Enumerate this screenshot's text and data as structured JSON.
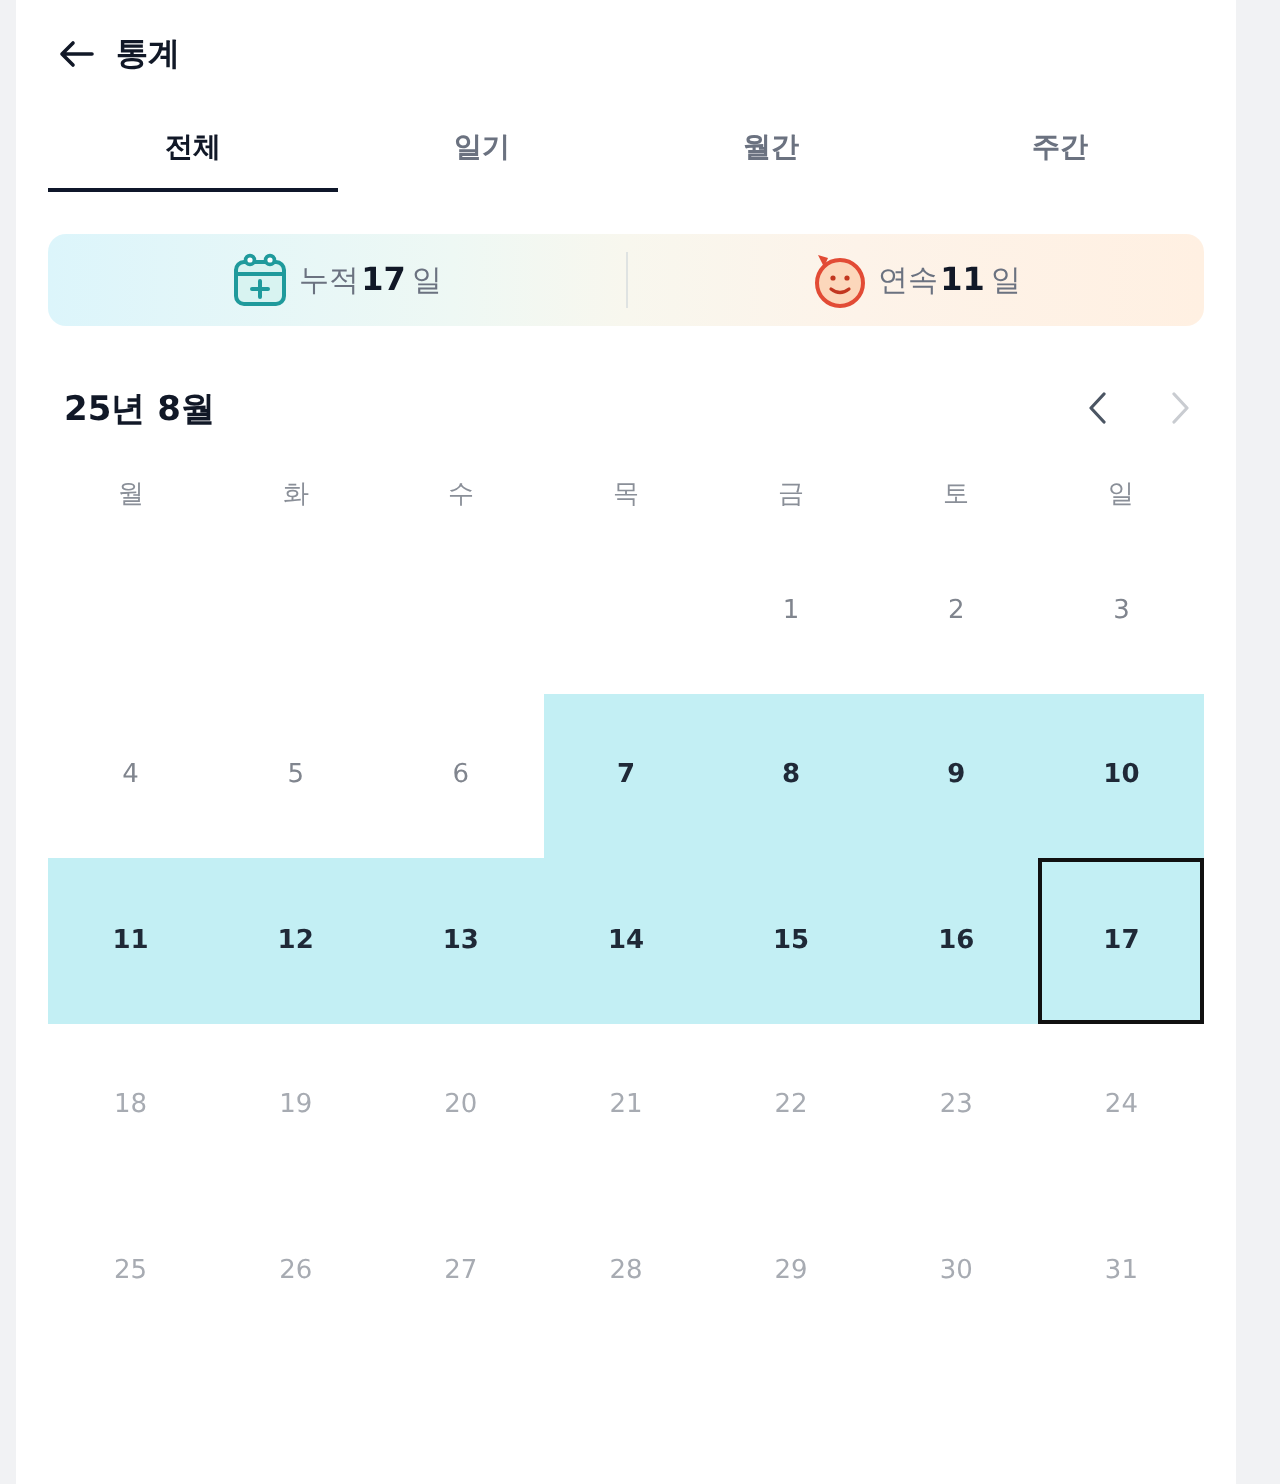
{
  "header": {
    "title": "통계"
  },
  "tabs": [
    {
      "label": "전체",
      "selected": true
    },
    {
      "label": "일기",
      "selected": false
    },
    {
      "label": "월간",
      "selected": false
    },
    {
      "label": "주간",
      "selected": false
    }
  ],
  "stats": [
    {
      "kind": "total",
      "text": "누적**17**일"
    },
    {
      "kind": "streak",
      "text": "연속**11**일"
    }
  ],
  "calendar": {
    "month_label": "25년 8월",
    "prev": {
      "disabled": false
    },
    "next": {
      "disabled": true
    },
    "weekdays": [
      "월",
      "화",
      "수",
      "목",
      "금",
      "토",
      "일"
    ],
    "weeks": [
      {
        "days": [
          {
            "label": "1",
            "kind": "past",
            "selected": false
          },
          {
            "label": "2",
            "kind": "past",
            "selected": false
          },
          {
            "label": "3",
            "kind": "past",
            "selected": false
          }
        ]
      },
      {
        "days": [
          {
            "label": "4",
            "kind": "past",
            "selected": false
          },
          {
            "label": "5",
            "kind": "past",
            "selected": false
          },
          {
            "label": "6",
            "kind": "past",
            "selected": false
          },
          {
            "label": "7",
            "kind": "recorded",
            "selected": false
          },
          {
            "label": "8",
            "kind": "recorded",
            "selected": false
          },
          {
            "label": "9",
            "kind": "recorded",
            "selected": false
          },
          {
            "label": "10",
            "kind": "recorded",
            "selected": false
          }
        ]
      },
      {
        "days": [
          {
            "label": "11",
            "kind": "recorded",
            "selected": false
          },
          {
            "label": "12",
            "kind": "recorded",
            "selected": false
          },
          {
            "label": "13",
            "kind": "recorded",
            "selected": false
          },
          {
            "label": "14",
            "kind": "recorded",
            "selected": false
          },
          {
            "label": "15",
            "kind": "recorded",
            "selected": false
          },
          {
            "label": "16",
            "kind": "recorded",
            "selected": false
          },
          {
            "label": "17",
            "kind": "recorded",
            "selected": true
          }
        ]
      },
      {
        "days": [
          {
            "label": "18",
            "kind": "future",
            "selected": false
          },
          {
            "label": "19",
            "kind": "future",
            "selected": false
          },
          {
            "label": "20",
            "kind": "future",
            "selected": false
          },
          {
            "label": "21",
            "kind": "future",
            "selected": false
          },
          {
            "label": "22",
            "kind": "future",
            "selected": false
          },
          {
            "label": "23",
            "kind": "future",
            "selected": false
          },
          {
            "label": "24",
            "kind": "future",
            "selected": false
          }
        ]
      },
      {
        "days": [
          {
            "label": "25",
            "kind": "future",
            "selected": false
          },
          {
            "label": "26",
            "kind": "future",
            "selected": false
          },
          {
            "label": "27",
            "kind": "future",
            "selected": false
          },
          {
            "label": "28",
            "kind": "future",
            "selected": false
          },
          {
            "label": "29",
            "kind": "future",
            "selected": false
          },
          {
            "label": "30",
            "kind": "future",
            "selected": false
          },
          {
            "label": "31",
            "kind": "future",
            "selected": false
          }
        ]
      }
    ]
  }
}
